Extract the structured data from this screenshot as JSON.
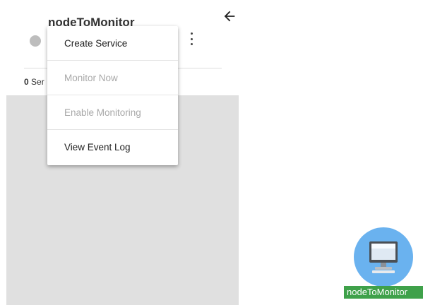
{
  "node": {
    "name": "nodeToMonitor",
    "status_color": "#bdbdbd",
    "services_count": "0",
    "services_label": "Ser"
  },
  "menu": {
    "items": [
      {
        "label": "Create Service",
        "enabled": true
      },
      {
        "label": "Monitor Now",
        "enabled": false
      },
      {
        "label": "Enable Monitoring",
        "enabled": false
      },
      {
        "label": "View Event Log",
        "enabled": true
      }
    ]
  },
  "topology": {
    "node_label": "nodeToMonitor",
    "node_icon": "desktop-computer-icon",
    "node_color": "#6ab2ef",
    "label_color": "#3fa14a"
  },
  "icons": {
    "back": "arrow-left-icon",
    "more": "more-vertical-icon"
  }
}
